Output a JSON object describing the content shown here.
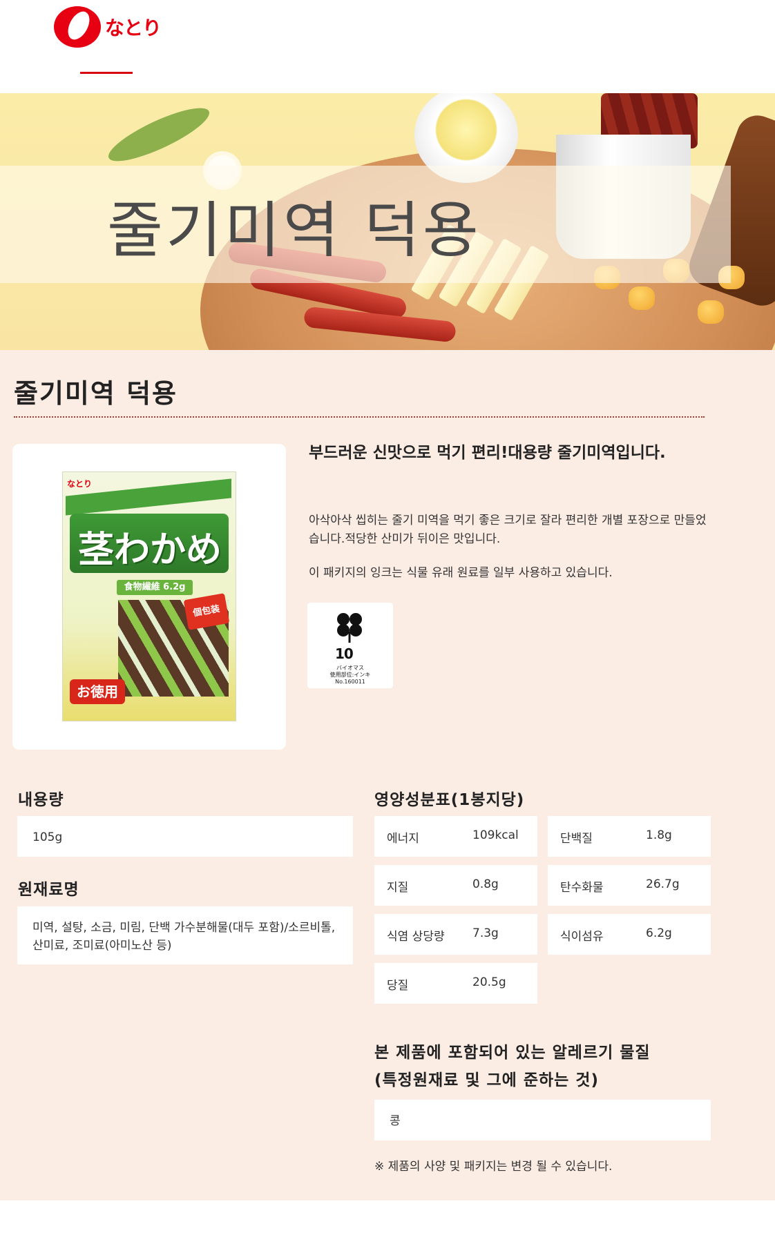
{
  "brand": {
    "name": "なとり",
    "logo_color": "#e60012"
  },
  "hero": {
    "title": "줄기미역 덕용"
  },
  "product": {
    "title": "줄기미역 덕용",
    "tagline": "부드러운 신맛으로 먹기 편리!대용량 줄기미역입니다.",
    "description": "아삭아삭 씹히는 줄기 미역을 먹기 좋은 크기로 잘라 편리한 개별 포장으로 만들었습니다.적당한 산미가 뒤이은 맛입니다.",
    "ink_note": "이 패키지의 잉크는 식물 유래 원료를 일부 사용하고 있습니다.",
    "package": {
      "brand": "なとり",
      "name": "茎わかめ",
      "fiber": "食物繊維 6.2g",
      "tag": "個包装",
      "badge": "お徳用"
    },
    "biomass_mark": {
      "number": "10",
      "line1": "バイオマス",
      "line2": "使用部位:インキ",
      "line3": "No.160011"
    }
  },
  "content_amount": {
    "heading": "내용량",
    "value": "105g"
  },
  "ingredients": {
    "heading": "원재료명",
    "value": "미역, 설탕, 소금, 미림, 단백 가수분해물(대두 포함)/소르비톨, 산미료, 조미료(아미노산 등)"
  },
  "nutrition": {
    "heading": "영양성분표(1봉지당)",
    "items": [
      {
        "label": "에너지",
        "value": "109kcal"
      },
      {
        "label": "단백질",
        "value": "1.8g"
      },
      {
        "label": "지질",
        "value": "0.8g"
      },
      {
        "label": "탄수화물",
        "value": "26.7g"
      },
      {
        "label": "식염 상당량",
        "value": "7.3g"
      },
      {
        "label": "식이섬유",
        "value": "6.2g"
      },
      {
        "label": "당질",
        "value": "20.5g"
      }
    ]
  },
  "allergens": {
    "heading_line1": "본 제품에 포함되어 있는 알레르기 물질",
    "heading_line2": "(특정원재료 및 그에 준하는 것)",
    "value": "콩"
  },
  "footnote": "※ 제품의 사양 및 패키지는 변경 될 수 있습니다.",
  "colors": {
    "accent": "#d7000f",
    "content_bg": "#fbece4",
    "dotted_rule": "#a2372f"
  }
}
